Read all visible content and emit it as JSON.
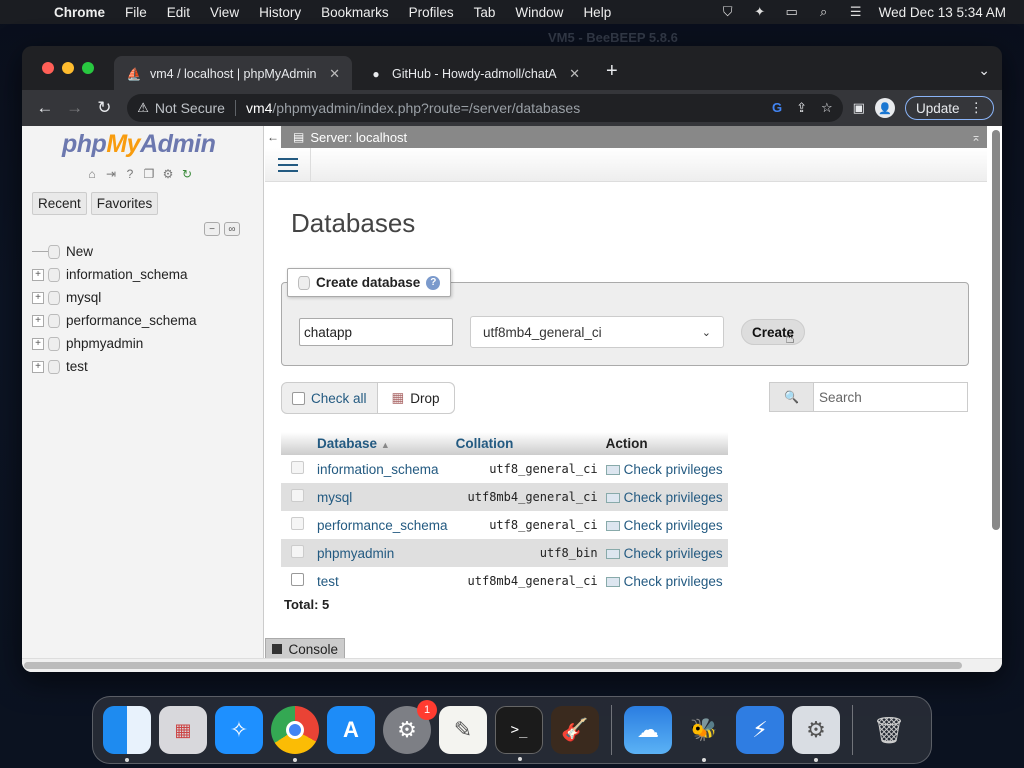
{
  "menubar": {
    "app": "Chrome",
    "items": [
      "File",
      "Edit",
      "View",
      "History",
      "Bookmarks",
      "Profiles",
      "Tab",
      "Window",
      "Help"
    ],
    "clock": "Wed Dec 13  5:34 AM"
  },
  "background_window_title": "VM5 - BeeBEEP 5.8.6",
  "browser": {
    "tabs": [
      {
        "title": "vm4 / localhost | phpMyAdmin",
        "icon": "phpmyadmin-icon",
        "active": true
      },
      {
        "title": "GitHub - Howdy-admoll/chatA",
        "icon": "github-icon",
        "active": false
      }
    ],
    "security_label": "Not Secure",
    "url_host": "vm4",
    "url_path": "/phpmyadmin/index.php?route=/server/databases",
    "update_label": "Update"
  },
  "pma": {
    "logo": {
      "php": "php",
      "my": "My",
      "admin": "Admin"
    },
    "nav_tabs": [
      "Recent",
      "Favorites"
    ],
    "tree": [
      {
        "label": "New",
        "type": "new"
      },
      {
        "label": "information_schema",
        "type": "db"
      },
      {
        "label": "mysql",
        "type": "db"
      },
      {
        "label": "performance_schema",
        "type": "db"
      },
      {
        "label": "phpmyadmin",
        "type": "db"
      },
      {
        "label": "test",
        "type": "db"
      }
    ],
    "server_label": "Server: localhost",
    "page_title": "Databases",
    "create": {
      "legend": "Create database",
      "db_name_value": "chatapp",
      "collation_value": "utf8mb4_general_ci",
      "button_label": "Create"
    },
    "check_all_label": "Check all",
    "drop_label": "Drop",
    "search_placeholder": "Search",
    "table": {
      "headers": {
        "database": "Database",
        "collation": "Collation",
        "action": "Action"
      },
      "rows": [
        {
          "name": "information_schema",
          "collation": "utf8_general_ci",
          "action": "Check privileges"
        },
        {
          "name": "mysql",
          "collation": "utf8mb4_general_ci",
          "action": "Check privileges"
        },
        {
          "name": "performance_schema",
          "collation": "utf8_general_ci",
          "action": "Check privileges"
        },
        {
          "name": "phpmyadmin",
          "collation": "utf8_bin",
          "action": "Check privileges"
        },
        {
          "name": "test",
          "collation": "utf8mb4_general_ci",
          "action": "Check privileges"
        }
      ]
    },
    "total": "Total: 5",
    "console_label": "Console"
  },
  "dock": {
    "items": [
      "finder",
      "launchpad",
      "safari",
      "chrome",
      "app-store",
      "system-preferences",
      "textedit",
      "terminal",
      "garageband",
      "weather",
      "beebeep",
      "vpn",
      "settings",
      "trash"
    ],
    "badge_count": "1"
  }
}
